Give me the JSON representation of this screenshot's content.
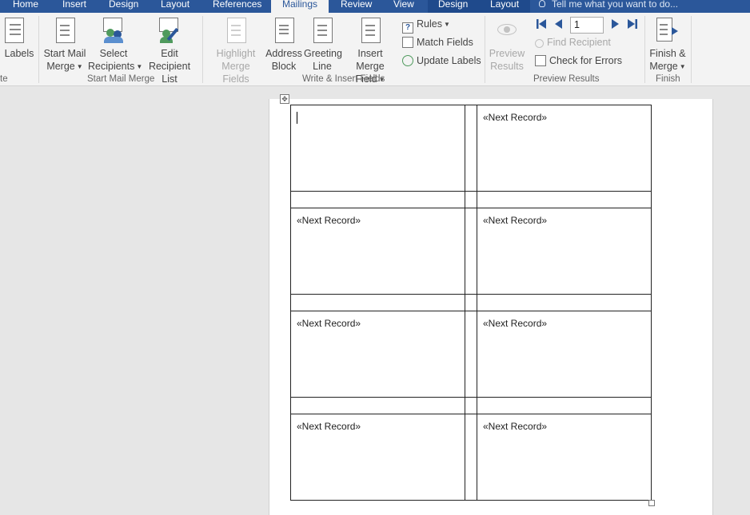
{
  "tabs": [
    "Home",
    "Insert",
    "Design",
    "Layout",
    "References",
    "Mailings",
    "Review",
    "View",
    "Design",
    "Layout"
  ],
  "active_tab": "Mailings",
  "tell_me_placeholder": "Tell me what you want to do...",
  "ribbon": {
    "create_group_label_fragment": "te",
    "labels_button": "Labels",
    "start_mail_merge": [
      "Start Mail",
      "Merge"
    ],
    "select_recipients": [
      "Select",
      "Recipients"
    ],
    "edit_recipient_list": [
      "Edit",
      "Recipient List"
    ],
    "start_mail_merge_group": "Start Mail Merge",
    "highlight_merge_fields": [
      "Highlight",
      "Merge Fields"
    ],
    "address_block": [
      "Address",
      "Block"
    ],
    "greeting_line": [
      "Greeting",
      "Line"
    ],
    "insert_merge_field": [
      "Insert Merge",
      "Field"
    ],
    "rules": "Rules",
    "match_fields": "Match Fields",
    "update_labels": "Update Labels",
    "write_insert_group": "Write & Insert Fields",
    "preview_results": [
      "Preview",
      "Results"
    ],
    "record_number": "1",
    "find_recipient": "Find Recipient",
    "check_for_errors": "Check for Errors",
    "preview_results_group": "Preview Results",
    "finish_merge": [
      "Finish &",
      "Merge"
    ],
    "finish_group": "Finish"
  },
  "colors": {
    "tabbar": "#2b579a",
    "ribbon_bg": "#f3f3f3",
    "accent": "#2b579a"
  },
  "document": {
    "labels": [
      [
        "",
        "«Next Record»"
      ],
      [
        "«Next Record»",
        "«Next Record»"
      ],
      [
        "«Next Record»",
        "«Next Record»"
      ],
      [
        "«Next Record»",
        "«Next Record»"
      ]
    ]
  }
}
